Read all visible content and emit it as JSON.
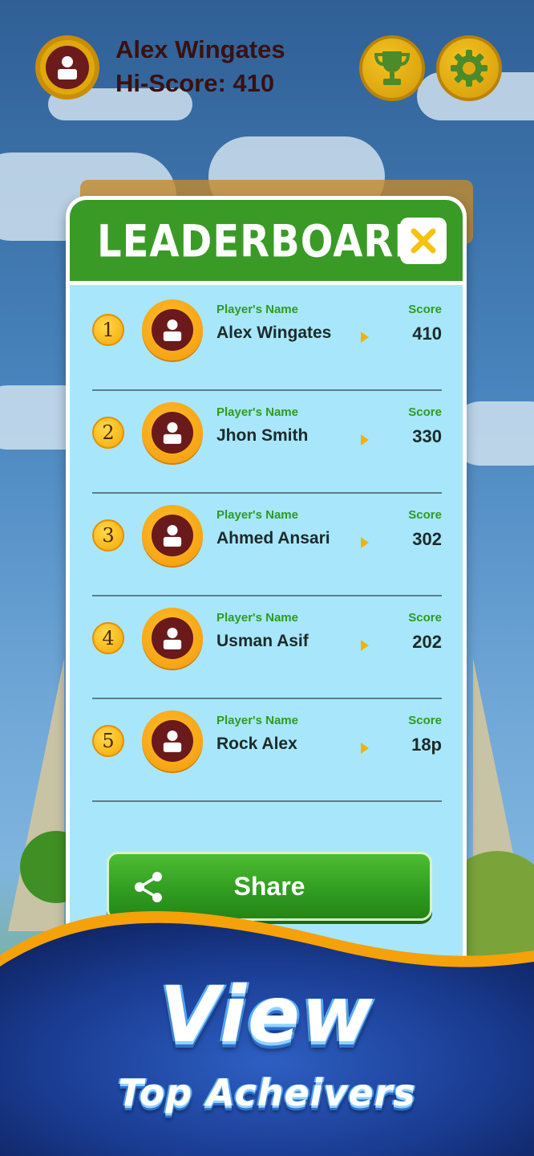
{
  "user": {
    "name": "Alex Wingates",
    "hiscore": "Hi-Score: 410"
  },
  "icons": {
    "trophy": "trophy-icon",
    "settings": "gear-icon",
    "close": "close-icon",
    "share": "share-icon",
    "avatar": "user-icon"
  },
  "leaderboard": {
    "title": "LEADERBOARD",
    "name_label": "Player's Name",
    "score_label": "Score",
    "rows": [
      {
        "rank": "1",
        "name": "Alex Wingates",
        "score": "410"
      },
      {
        "rank": "2",
        "name": "Jhon Smith",
        "score": "330"
      },
      {
        "rank": "3",
        "name": "Ahmed Ansari",
        "score": "302"
      },
      {
        "rank": "4",
        "name": "Usman Asif",
        "score": "202"
      },
      {
        "rank": "5",
        "name": "Rock Alex",
        "score": "18p"
      }
    ],
    "share_label": "Share"
  },
  "promo": {
    "headline": "View",
    "subline": "Top Acheivers"
  },
  "colors": {
    "header_green": "#3a9a26",
    "panel_bg": "#a8e7fb",
    "accent_gold": "#f39a0c",
    "avatar_maroon": "#6a1a1a",
    "banner_blue": "#1d3f8f",
    "banner_orange": "#f5a10a"
  }
}
